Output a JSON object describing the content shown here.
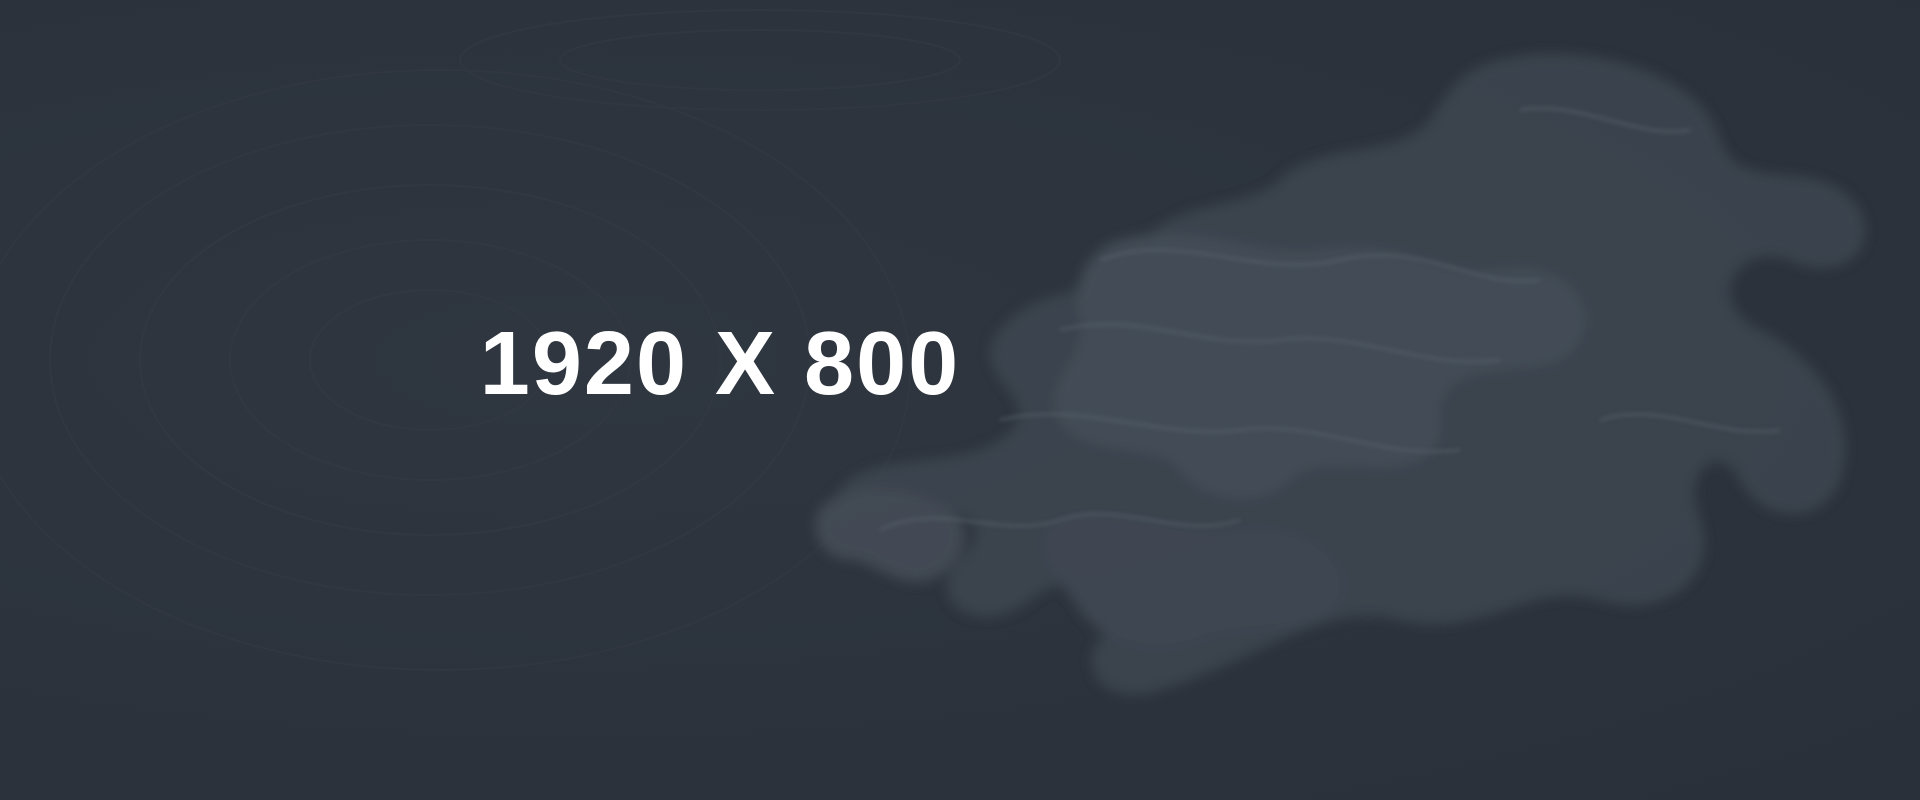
{
  "banner": {
    "size_label": "1920 X 800"
  },
  "colors": {
    "background": "#2c333d",
    "smoke": "#4a535d",
    "text": "#ffffff"
  }
}
